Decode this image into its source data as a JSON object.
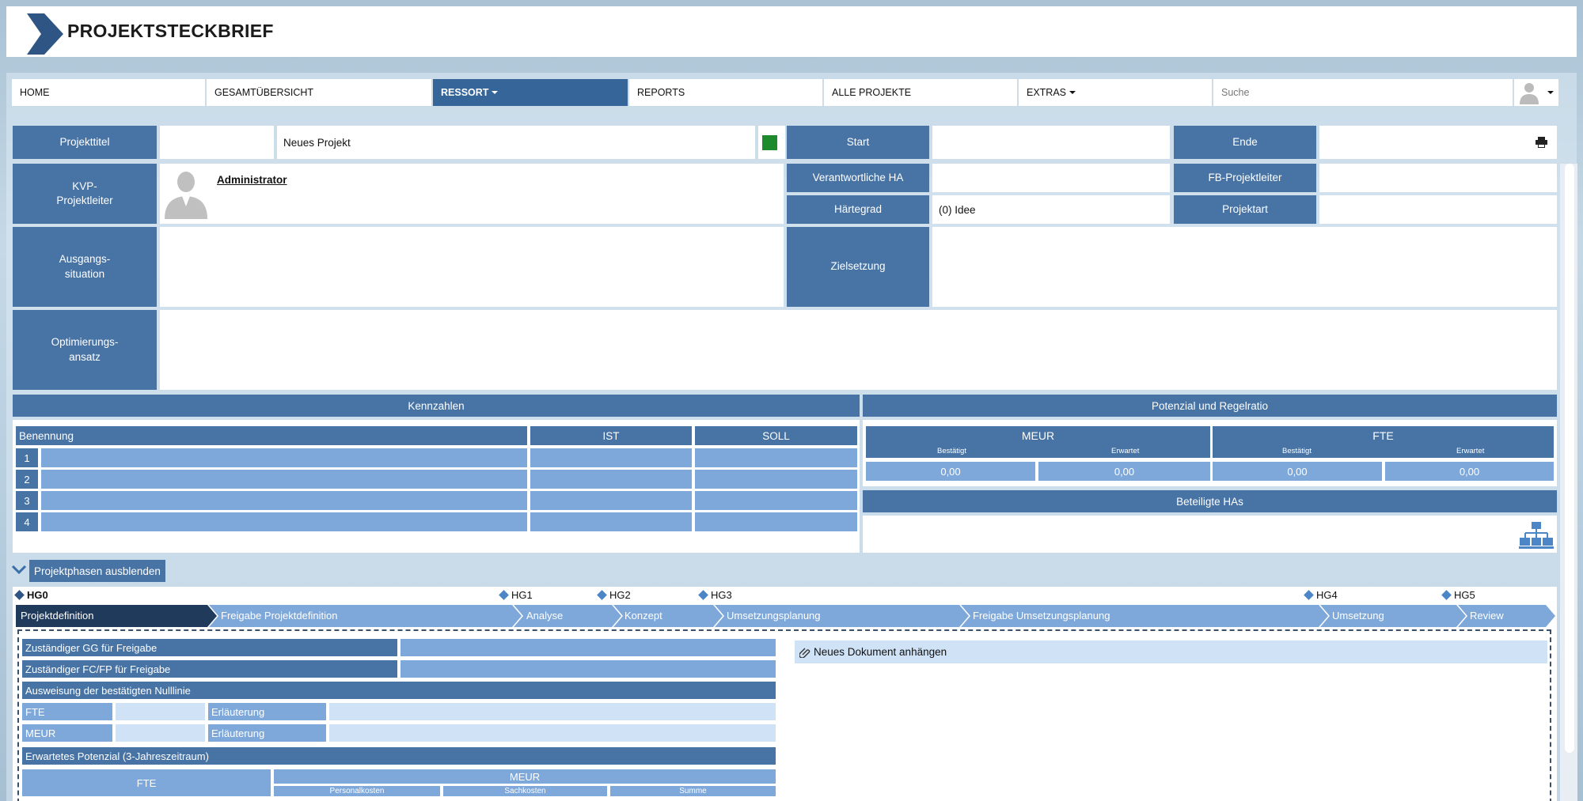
{
  "app": {
    "title": "PROJEKTSTECKBRIEF"
  },
  "nav": {
    "items": [
      {
        "label": "HOME",
        "active": false,
        "dropdown": false
      },
      {
        "label": "GESAMTÜBERSICHT",
        "active": false,
        "dropdown": false
      },
      {
        "label": "RESSORT",
        "active": true,
        "dropdown": true
      },
      {
        "label": "REPORTS",
        "active": false,
        "dropdown": false
      },
      {
        "label": "ALLE PROJEKTE",
        "active": false,
        "dropdown": false
      },
      {
        "label": "EXTRAS",
        "active": false,
        "dropdown": true
      }
    ],
    "search_placeholder": "Suche",
    "user_icon": "user-avatar-icon"
  },
  "colors": {
    "accent": "#4773a5",
    "active_nav": "#36659a",
    "row_fill": "#7ea8da",
    "light_fill": "#cfe2f6",
    "status": "#1e8a2e"
  },
  "project": {
    "title_label": "Projekttitel",
    "title_value": "Neues Projekt",
    "start_label": "Start",
    "end_label": "Ende",
    "kvp_label": "KVP-\nProjektleiter",
    "kvp_name": "Administrator",
    "verantwortliche_label": "Verantwortliche HA",
    "fb_label": "FB-Projektleiter",
    "haertegrad_label": "Härtegrad",
    "haertegrad_value": "(0) Idee",
    "projektart_label": "Projektart",
    "ausgang_label": "Ausgangs-\nsituation",
    "ziel_label": "Zielsetzung",
    "optimierung_label": "Optimierungs-\nansatz"
  },
  "kennzahlen": {
    "title": "Kennzahlen",
    "col_name": "Benennung",
    "col_ist": "IST",
    "col_soll": "SOLL",
    "rows": [
      "1",
      "2",
      "3",
      "4"
    ]
  },
  "potenzial": {
    "title": "Potenzial und Regelratio",
    "meur": "MEUR",
    "fte": "FTE",
    "bestaetigt": "Bestätigt",
    "erwartet": "Erwartet",
    "values": [
      "0,00",
      "0,00",
      "0,00",
      "0,00"
    ],
    "beteiligte": "Beteiligte HAs"
  },
  "phases": {
    "toggle_label": "Projektphasen ausblenden",
    "gates": [
      "HG0",
      "HG1",
      "HG2",
      "HG3",
      "HG4",
      "HG5"
    ],
    "steps": [
      "Projektdefinition",
      "Freigabe Projektdefinition",
      "Analyse",
      "Konzept",
      "Umsetzungsplanung",
      "Freigabe Umsetzungsplanung",
      "Umsetzung",
      "Review"
    ]
  },
  "form": {
    "gg_label": "Zuständiger GG für Freigabe",
    "fc_label": "Zuständiger FC/FP für Freigabe",
    "nulllinie_label": "Ausweisung der bestätigten Nulllinie",
    "fte_label": "FTE",
    "meur_label": "MEUR",
    "erl1": "Erläuterung",
    "erl2": "Erläuterung",
    "potenzial_label": "Erwartetes Potenzial (3-Jahreszeitraum)",
    "pot_fte": "FTE",
    "pot_meur": "MEUR",
    "personalkosten": "Personalkosten",
    "sachkosten": "Sachkosten",
    "summe": "Summe",
    "doc_attach": "Neues Dokument anhängen"
  }
}
